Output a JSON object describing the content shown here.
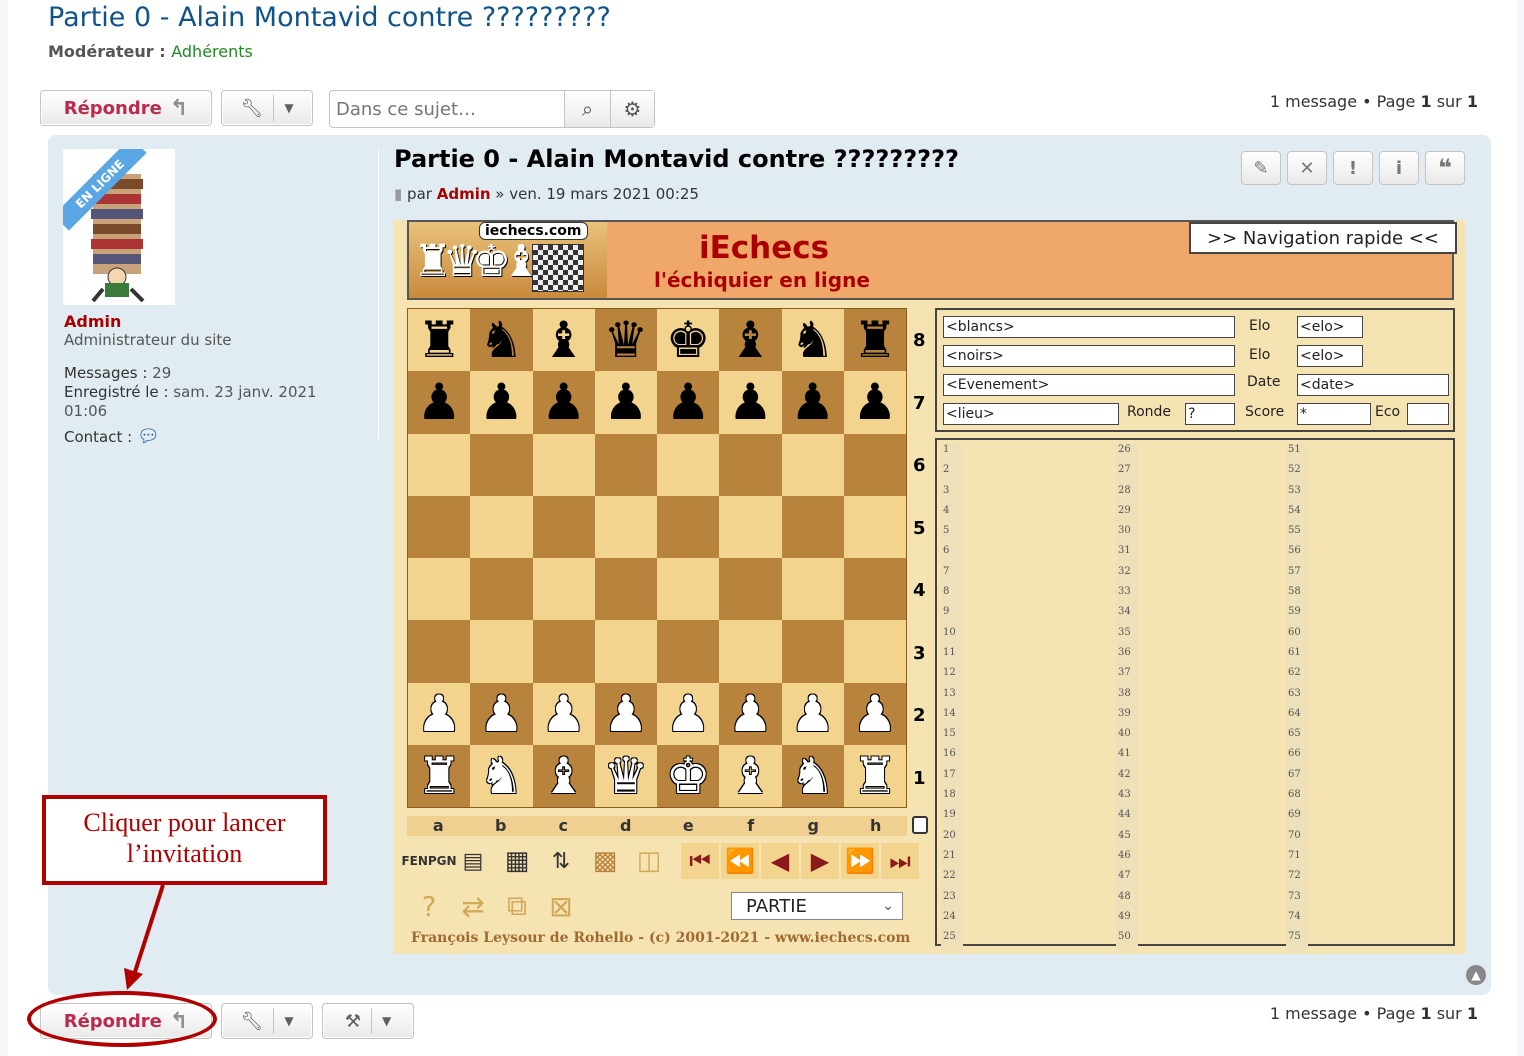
{
  "topic": {
    "title": "Partie 0 - Alain Montavid contre ?????????",
    "moderator_label": "Modérateur :",
    "moderator_group": "Adhérents"
  },
  "toolbar": {
    "reply_label": "Répondre",
    "search_placeholder": "Dans ce sujet…",
    "pagination": {
      "count_text": "1 message • Page",
      "page": "1",
      "sur": "sur",
      "total": "1"
    }
  },
  "post": {
    "author": {
      "online_badge": "EN LIGNE",
      "name": "Admin",
      "rank": "Administrateur du site",
      "messages_label": "Messages :",
      "messages_value": "29",
      "registered_label": "Enregistré le :",
      "registered_value": "sam. 23 janv. 2021",
      "registered_time": "01:06",
      "contact_label": "Contact :"
    },
    "title": "Partie 0 - Alain Montavid contre ?????????",
    "meta_par": "par",
    "meta_author": "Admin",
    "meta_date": "» ven. 19 mars 2021 00:25"
  },
  "chess": {
    "logo_text": "iechecs.com",
    "brand": "iEchecs",
    "tagline": "l'échiquier en ligne",
    "nav_button": ">> Navigation rapide <<",
    "ranks": [
      "8",
      "7",
      "6",
      "5",
      "4",
      "3",
      "2",
      "1"
    ],
    "files": [
      "a",
      "b",
      "c",
      "d",
      "e",
      "f",
      "g",
      "h"
    ],
    "board": [
      [
        "bR",
        "bN",
        "bB",
        "bQ",
        "bK",
        "bB",
        "bN",
        "bR"
      ],
      [
        "bP",
        "bP",
        "bP",
        "bP",
        "bP",
        "bP",
        "bP",
        "bP"
      ],
      [
        "",
        "",
        "",
        "",
        "",
        "",
        "",
        ""
      ],
      [
        "",
        "",
        "",
        "",
        "",
        "",
        "",
        ""
      ],
      [
        "",
        "",
        "",
        "",
        "",
        "",
        "",
        ""
      ],
      [
        "",
        "",
        "",
        "",
        "",
        "",
        "",
        ""
      ],
      [
        "wP",
        "wP",
        "wP",
        "wP",
        "wP",
        "wP",
        "wP",
        "wP"
      ],
      [
        "wR",
        "wN",
        "wB",
        "wQ",
        "wK",
        "wB",
        "wN",
        "wR"
      ]
    ],
    "fields": {
      "blancs": "<blancs>",
      "noirs": "<noirs>",
      "evenement": "<Evenement>",
      "lieu": "<lieu>",
      "elo_label": "Elo",
      "elo1": "<elo>",
      "elo2": "<elo>",
      "date_label": "Date",
      "date": "<date>",
      "ronde_label": "Ronde",
      "ronde": "?",
      "score_label": "Score",
      "score": "*",
      "eco_label": "Eco"
    },
    "fen_label": "FEN",
    "pgn_label": "PGN",
    "select_value": "PARTIE",
    "copyright": "François Leysour de Rohello - (c) 2001-2021 - www.iechecs.com"
  },
  "annotation": {
    "line1": "Cliquer pour lancer",
    "line2": "l’invitation"
  },
  "colors": {
    "accent": "#105289",
    "reply": "#bc2a4d",
    "annotation": "#b00000",
    "panel": "#e1ebf2"
  }
}
